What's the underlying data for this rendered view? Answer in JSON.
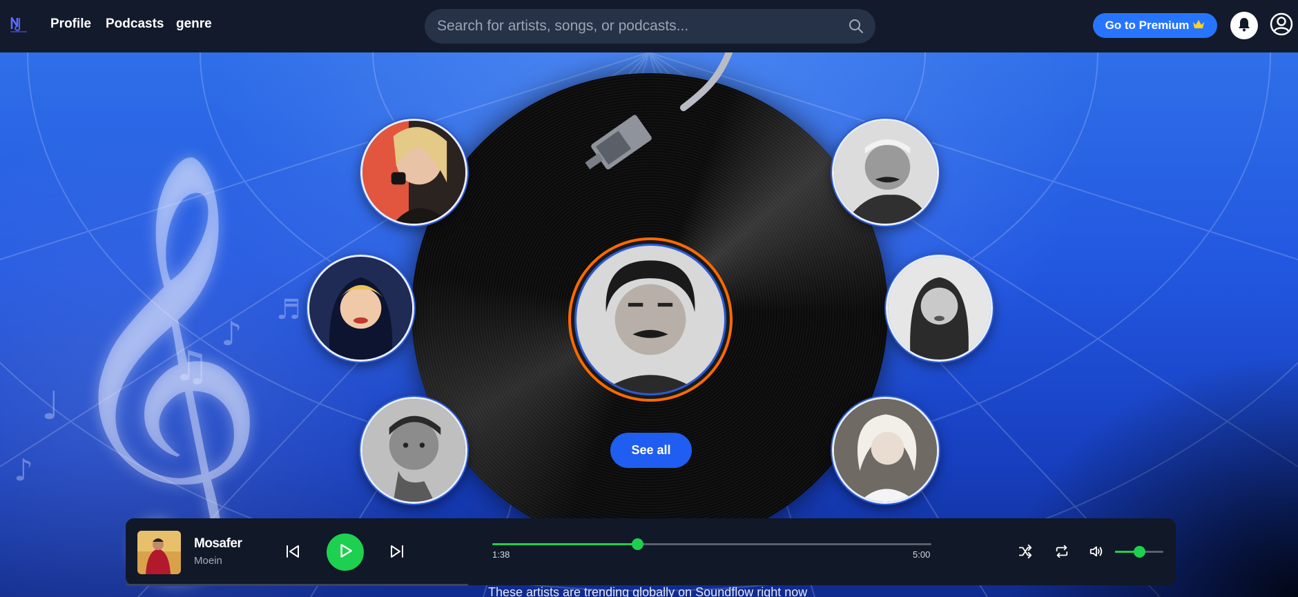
{
  "header": {
    "nav": [
      "Profile",
      "Podcasts",
      "genre"
    ],
    "search_placeholder": "Search for artists, songs, or podcasts...",
    "premium_label": "Go to Premium"
  },
  "hero": {
    "see_all_label": "See all",
    "trending_text": "These artists are trending globally on Soundflow right now"
  },
  "player": {
    "title": "Mosafer",
    "artist": "Moein",
    "current_time": "1:38",
    "duration": "5:00",
    "progress_fraction": 0.33,
    "volume_fraction": 0.5
  },
  "icons": {
    "logo": "logo-icon",
    "search": "search-icon",
    "crown": "crown-icon",
    "bell": "bell-icon",
    "user": "user-icon",
    "prev": "skip-back-icon",
    "play": "play-icon",
    "next": "skip-forward-icon",
    "shuffle": "shuffle-icon",
    "repeat": "repeat-icon",
    "volume": "volume-icon"
  },
  "colors": {
    "accent_green": "#1ed04f",
    "premium_blue": "#2775ff",
    "featured_ring": "#ff6a00",
    "topbar_bg": "#121a2b",
    "player_bg": "#111827"
  }
}
